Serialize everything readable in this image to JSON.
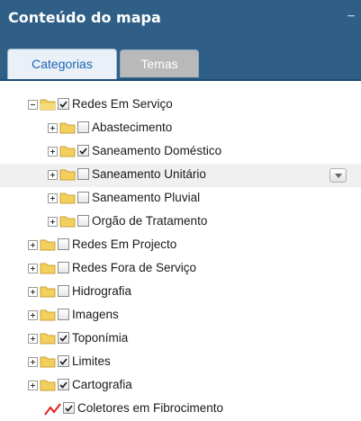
{
  "panel": {
    "title": "Conteúdo do mapa",
    "collapse_glyph": "−"
  },
  "tabs": [
    {
      "label": "Categorias",
      "active": true
    },
    {
      "label": "Temas",
      "active": false
    }
  ],
  "tree": [
    {
      "label": "Redes Em Serviço",
      "expanded": true,
      "checked": true
    },
    {
      "label": "Abastecimento",
      "expanded": false,
      "checked": false
    },
    {
      "label": "Saneamento Doméstico",
      "expanded": false,
      "checked": true
    },
    {
      "label": "Saneamento Unitário",
      "expanded": false,
      "checked": false,
      "hovered": true
    },
    {
      "label": "Saneamento Pluvial",
      "expanded": false,
      "checked": false
    },
    {
      "label": "Orgão de Tratamento",
      "expanded": false,
      "checked": false
    },
    {
      "label": "Redes Em Projecto",
      "expanded": false,
      "checked": false
    },
    {
      "label": "Redes Fora de Serviço",
      "expanded": false,
      "checked": false
    },
    {
      "label": "Hidrografia",
      "expanded": false,
      "checked": false
    },
    {
      "label": "Imagens",
      "expanded": false,
      "checked": false
    },
    {
      "label": "Toponímia",
      "expanded": false,
      "checked": true
    },
    {
      "label": "Limites",
      "expanded": false,
      "checked": true
    },
    {
      "label": "Cartografia",
      "expanded": false,
      "checked": true
    },
    {
      "label": "Coletores em Fibrocimento",
      "checked": true,
      "symbol": "red-line-icon"
    }
  ],
  "colors": {
    "header": "#2f5f86",
    "active_tab_text": "#1e64b4",
    "inactive_tab": "#b9b9b9",
    "folder": "#f3cf5b",
    "symbol_line": "#e02020"
  }
}
